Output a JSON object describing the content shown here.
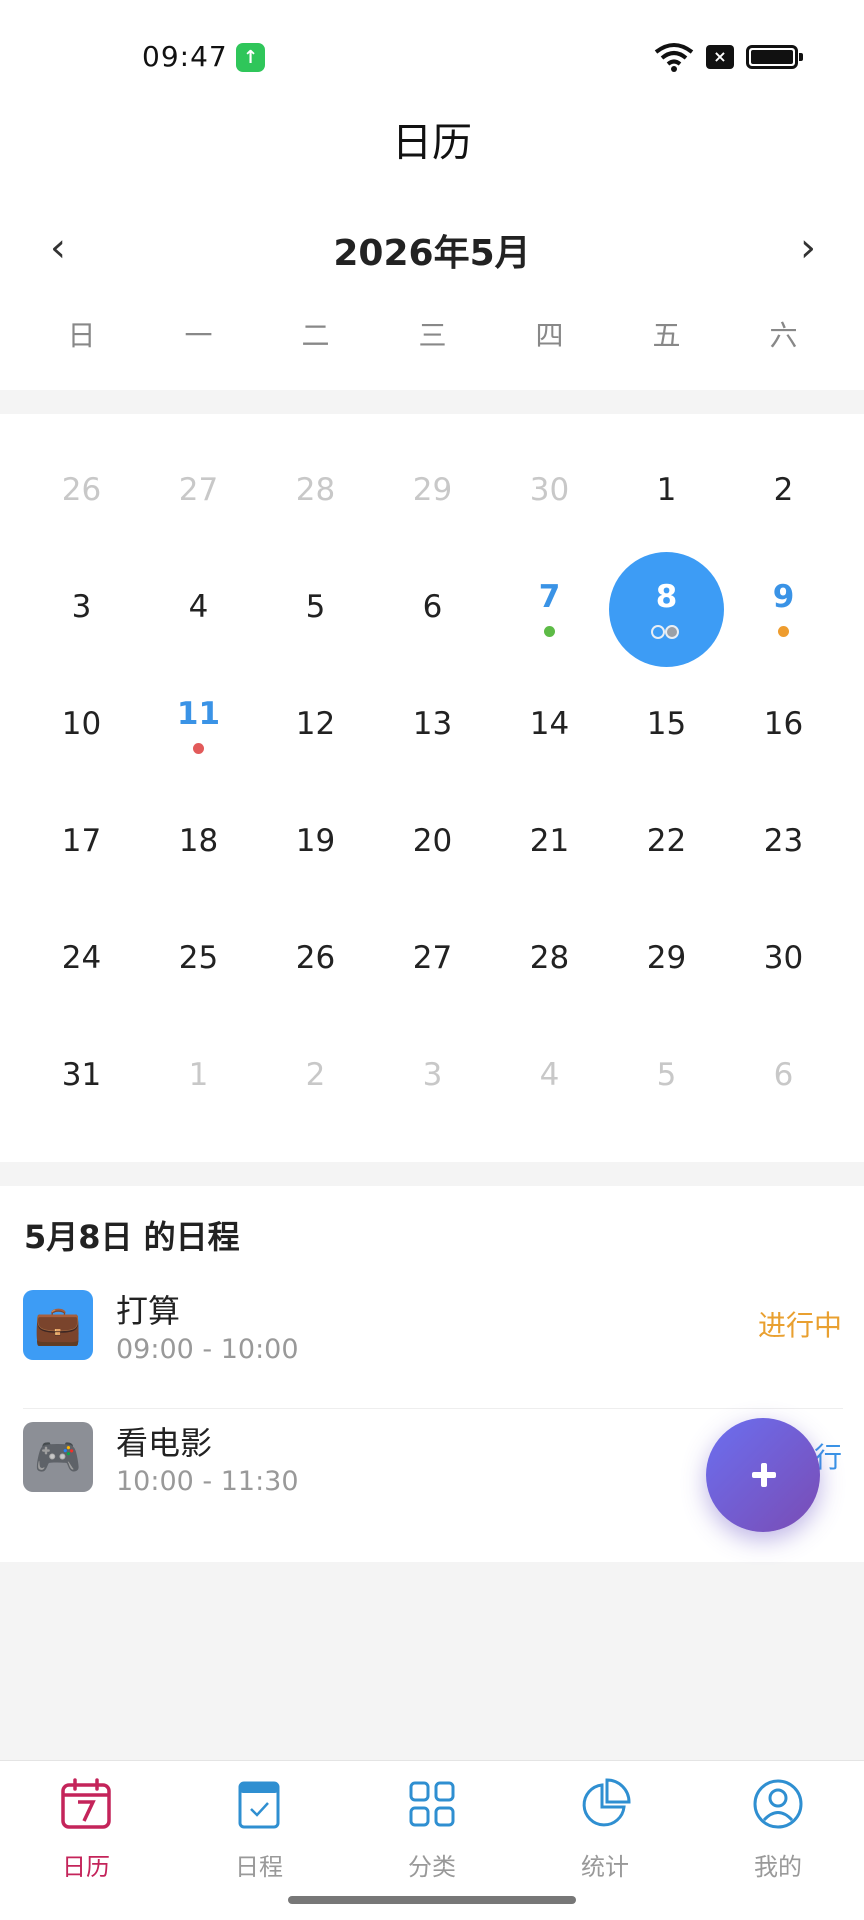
{
  "status_bar": {
    "time": "09:47"
  },
  "header": {
    "title": "日历",
    "month": "2026年5月",
    "prev_glyph": "‹",
    "next_glyph": "›",
    "weekdays": [
      "日",
      "一",
      "二",
      "三",
      "四",
      "五",
      "六"
    ]
  },
  "calendar": {
    "weeks": [
      [
        {
          "d": "26",
          "other": true
        },
        {
          "d": "27",
          "other": true
        },
        {
          "d": "28",
          "other": true
        },
        {
          "d": "29",
          "other": true
        },
        {
          "d": "30",
          "other": true
        },
        {
          "d": "1"
        },
        {
          "d": "2"
        }
      ],
      [
        {
          "d": "3"
        },
        {
          "d": "4"
        },
        {
          "d": "5"
        },
        {
          "d": "6"
        },
        {
          "d": "7",
          "dot": "#5dbb46"
        },
        {
          "d": "8",
          "selected": true
        },
        {
          "d": "9",
          "dot": "#ee9c2e"
        }
      ],
      [
        {
          "d": "10"
        },
        {
          "d": "11",
          "dot": "#e25a5a"
        },
        {
          "d": "12"
        },
        {
          "d": "13"
        },
        {
          "d": "14"
        },
        {
          "d": "15"
        },
        {
          "d": "16"
        }
      ],
      [
        {
          "d": "17"
        },
        {
          "d": "18"
        },
        {
          "d": "19"
        },
        {
          "d": "20"
        },
        {
          "d": "21"
        },
        {
          "d": "22"
        },
        {
          "d": "23"
        }
      ],
      [
        {
          "d": "24"
        },
        {
          "d": "25"
        },
        {
          "d": "26"
        },
        {
          "d": "27"
        },
        {
          "d": "28"
        },
        {
          "d": "29"
        },
        {
          "d": "30"
        }
      ],
      [
        {
          "d": "31"
        },
        {
          "d": "1",
          "other": true
        },
        {
          "d": "2",
          "other": true
        },
        {
          "d": "3",
          "other": true
        },
        {
          "d": "4",
          "other": true
        },
        {
          "d": "5",
          "other": true
        },
        {
          "d": "6",
          "other": true
        }
      ]
    ],
    "selected_color": "#3d9cf5"
  },
  "schedule": {
    "title": "5月8日 的日程",
    "events": [
      {
        "title": "打算",
        "time": "09:00 - 10:00",
        "status": "进行中",
        "status_color": "#e9a030",
        "icon": "briefcase-icon",
        "icon_glyph": "💼",
        "icon_bg": "#3d9cf5"
      },
      {
        "title": "看电影",
        "time": "10:00 - 11:30",
        "status": "行",
        "status_color": "#3a93e6",
        "icon": "game-controller-icon",
        "icon_glyph": "🎮",
        "icon_bg": "#8c8f96"
      }
    ]
  },
  "tabs": [
    {
      "label": "日历",
      "icon": "calendar-icon",
      "active": true
    },
    {
      "label": "日程",
      "icon": "clipboard-icon",
      "active": false
    },
    {
      "label": "分类",
      "icon": "grid-icon",
      "active": false
    },
    {
      "label": "统计",
      "icon": "pie-chart-icon",
      "active": false
    },
    {
      "label": "我的",
      "icon": "profile-icon",
      "active": false
    }
  ]
}
